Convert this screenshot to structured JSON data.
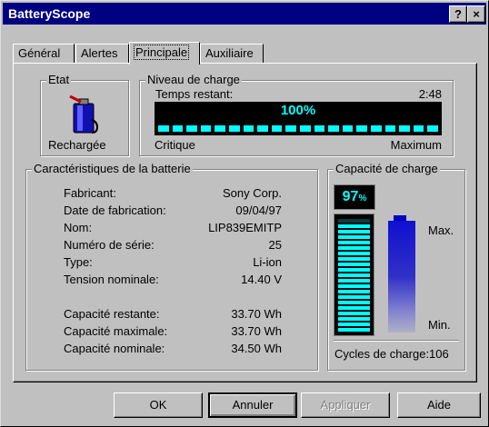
{
  "window": {
    "title": "BatteryScope",
    "help_label": "?",
    "close_label": "×"
  },
  "tabs": [
    {
      "label": "Général"
    },
    {
      "label": "Alertes"
    },
    {
      "label": "Principale"
    },
    {
      "label": "Auxiliaire"
    }
  ],
  "etat": {
    "label": "Etat",
    "status": "Rechargée",
    "icon": "battery-charging-icon"
  },
  "niveau": {
    "label": "Niveau de charge",
    "time_label": "Temps restant:",
    "time_value": "2:48",
    "percent": "100%",
    "level": 100,
    "min_label": "Critique",
    "max_label": "Maximum"
  },
  "caracteristiques": {
    "label": "Caractéristiques de la batterie",
    "rows": [
      {
        "key": "Fabricant:",
        "value": "Sony Corp."
      },
      {
        "key": "Date de fabrication:",
        "value": "09/04/97"
      },
      {
        "key": "Nom:",
        "value": "LIP839EMITP"
      },
      {
        "key": "Numéro de série:",
        "value": "25"
      },
      {
        "key": "Type:",
        "value": "Li-ion"
      },
      {
        "key": "Tension nominale:",
        "value": "14.40 V"
      }
    ],
    "rows2": [
      {
        "key": "Capacité restante:",
        "value": "33.70 Wh"
      },
      {
        "key": "Capacité maximale:",
        "value": "33.70 Wh"
      },
      {
        "key": "Capacité nominale:",
        "value": "34.50 Wh"
      }
    ]
  },
  "capacite": {
    "label": "Capacité de charge",
    "percent": "97",
    "percent_sign": "%",
    "level": 97,
    "max_label": "Max.",
    "min_label": "Min.",
    "cycles": "Cycles de charge:106"
  },
  "buttons": {
    "ok": "OK",
    "cancel": "Annuler",
    "apply": "Appliquer",
    "help": "Aide"
  },
  "colors": {
    "titlebar": "#000080",
    "lcd": "#00ffff",
    "battery": "#1010d0"
  }
}
